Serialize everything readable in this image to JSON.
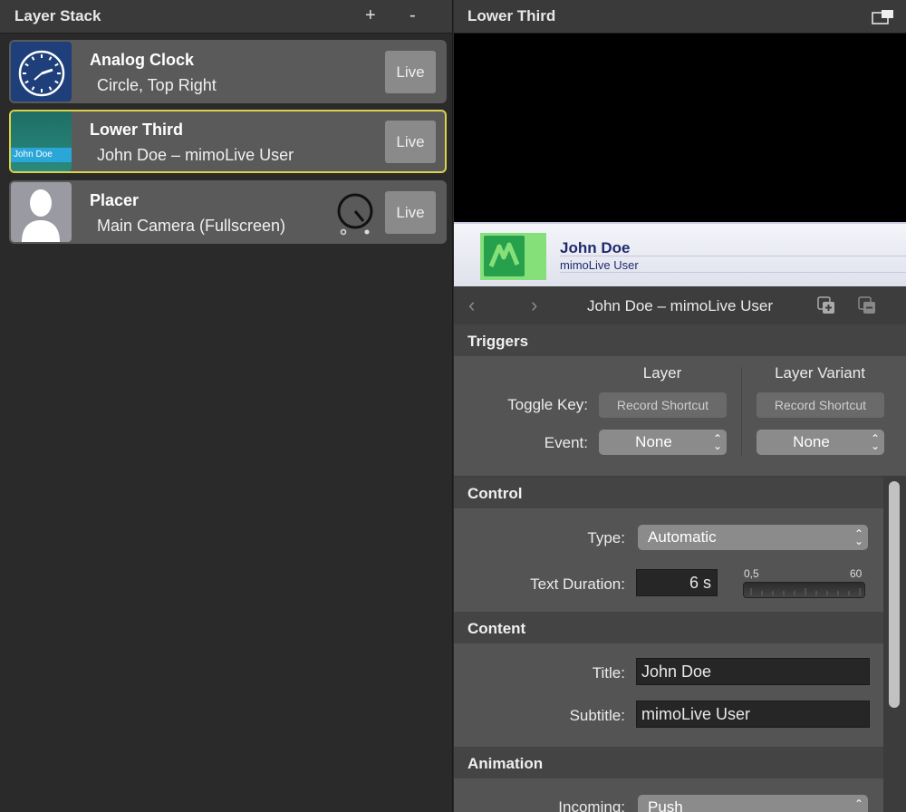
{
  "layer_stack": {
    "title": "Layer Stack",
    "add_label": "+",
    "remove_label": "-",
    "items": [
      {
        "name": "Analog Clock",
        "subtitle": "Circle, Top Right",
        "live_label": "Live",
        "thumb_icon": "analog-clock-icon"
      },
      {
        "name": "Lower Third",
        "subtitle": "John Doe – mimoLive User",
        "live_label": "Live",
        "thumb_text": "John Doe",
        "selected": true
      },
      {
        "name": "Placer",
        "subtitle": "Main Camera (Fullscreen)",
        "live_label": "Live",
        "thumb_icon": "person-silhouette-icon",
        "knob_icon": "volume-knob-icon"
      }
    ]
  },
  "detail": {
    "title": "Lower Third",
    "window_icon": "detach-window-icon",
    "preview": {
      "title": "John Doe",
      "subtitle": "mimoLive User",
      "colors": {
        "logo_bg": "#86e07a",
        "logo_fg": "#26a04a",
        "text": "#1f2a6e"
      }
    },
    "variant_nav": {
      "title": "John Doe – mimoLive User",
      "prev_icon": "chevron-left-icon",
      "next_icon": "chevron-right-icon",
      "add_icon": "add-variant-icon",
      "remove_icon": "remove-variant-icon"
    },
    "triggers": {
      "header": "Triggers",
      "col_layer": "Layer",
      "col_variant": "Layer Variant",
      "toggle_key_label": "Toggle Key:",
      "record_shortcut_label": "Record Shortcut",
      "event_label": "Event:",
      "event_layer_value": "None",
      "event_variant_value": "None"
    },
    "control": {
      "header": "Control",
      "type_label": "Type:",
      "type_value": "Automatic",
      "duration_label": "Text Duration:",
      "duration_value": "6 s",
      "slider_min": "0,5",
      "slider_max": "60"
    },
    "content": {
      "header": "Content",
      "title_label": "Title:",
      "title_value": "John Doe",
      "subtitle_label": "Subtitle:",
      "subtitle_value": "mimoLive User"
    },
    "animation": {
      "header": "Animation",
      "incoming_label": "Incoming:",
      "incoming_value": "Push"
    }
  }
}
